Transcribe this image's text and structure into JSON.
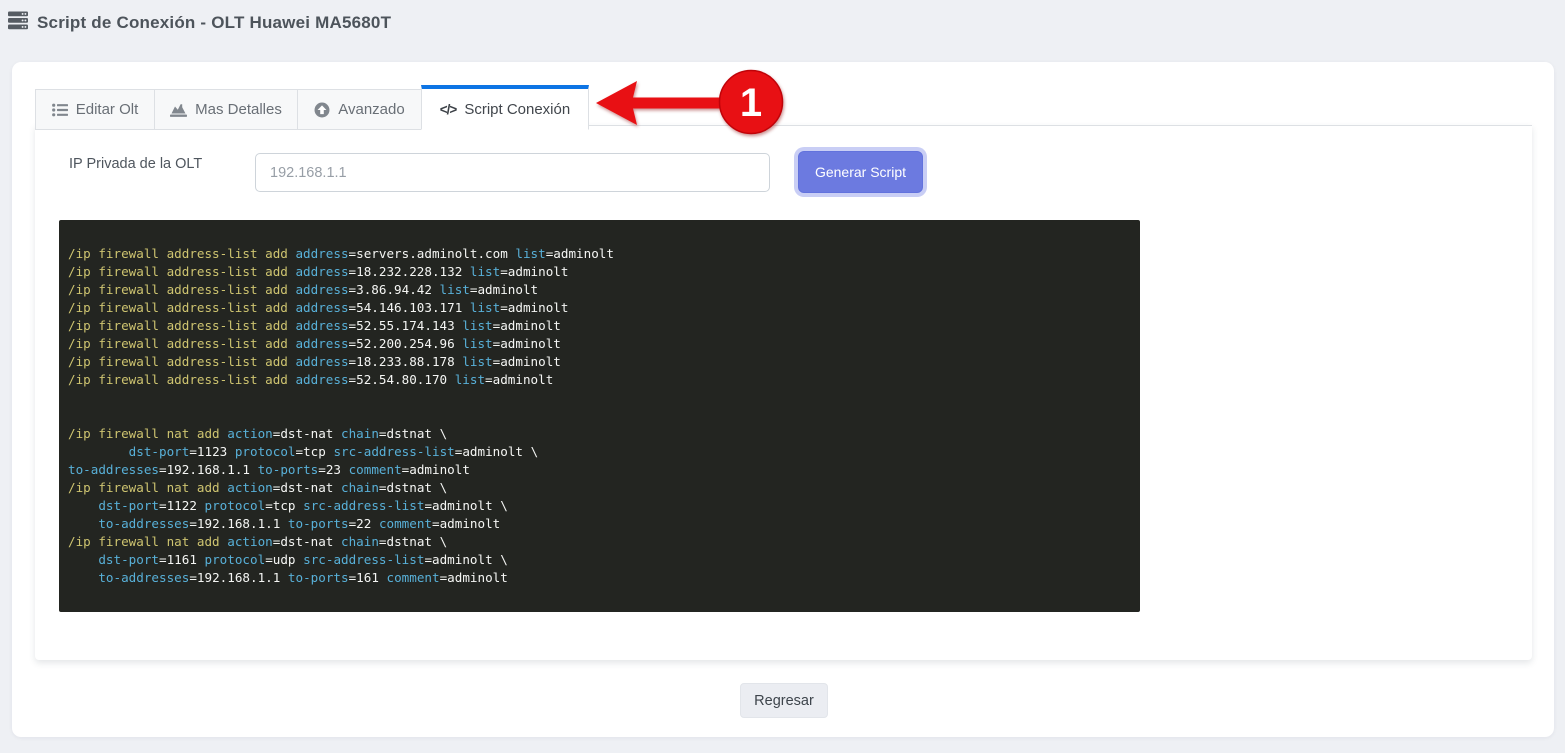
{
  "header": {
    "title": "Script de Conexión - OLT Huawei MA5680T"
  },
  "tabs": [
    {
      "label": "Editar Olt",
      "icon": "list-icon",
      "active": false
    },
    {
      "label": "Mas Detalles",
      "icon": "chart-area-icon",
      "active": false
    },
    {
      "label": "Avanzado",
      "icon": "arrow-circle-up-icon",
      "active": false
    },
    {
      "label": "Script Conexión",
      "icon": "code-icon",
      "active": true
    }
  ],
  "icons": {
    "code_glyph": "</>"
  },
  "form": {
    "ip_label": "IP Privada de la OLT",
    "ip_value": "192.168.1.1",
    "generate_button": "Generar Script"
  },
  "script": {
    "lines": [
      [
        [
          "c",
          "/ip firewall address-list add "
        ],
        [
          "p",
          "address"
        ],
        [
          "v",
          "=servers.adminolt.com "
        ],
        [
          "p",
          "list"
        ],
        [
          "v",
          "=adminolt"
        ]
      ],
      [
        [
          "c",
          "/ip firewall address-list add "
        ],
        [
          "p",
          "address"
        ],
        [
          "v",
          "=18.232.228.132 "
        ],
        [
          "p",
          "list"
        ],
        [
          "v",
          "=adminolt"
        ]
      ],
      [
        [
          "c",
          "/ip firewall address-list add "
        ],
        [
          "p",
          "address"
        ],
        [
          "v",
          "=3.86.94.42 "
        ],
        [
          "p",
          "list"
        ],
        [
          "v",
          "=adminolt"
        ]
      ],
      [
        [
          "c",
          "/ip firewall address-list add "
        ],
        [
          "p",
          "address"
        ],
        [
          "v",
          "=54.146.103.171 "
        ],
        [
          "p",
          "list"
        ],
        [
          "v",
          "=adminolt"
        ]
      ],
      [
        [
          "c",
          "/ip firewall address-list add "
        ],
        [
          "p",
          "address"
        ],
        [
          "v",
          "=52.55.174.143 "
        ],
        [
          "p",
          "list"
        ],
        [
          "v",
          "=adminolt"
        ]
      ],
      [
        [
          "c",
          "/ip firewall address-list add "
        ],
        [
          "p",
          "address"
        ],
        [
          "v",
          "=52.200.254.96 "
        ],
        [
          "p",
          "list"
        ],
        [
          "v",
          "=adminolt"
        ]
      ],
      [
        [
          "c",
          "/ip firewall address-list add "
        ],
        [
          "p",
          "address"
        ],
        [
          "v",
          "=18.233.88.178 "
        ],
        [
          "p",
          "list"
        ],
        [
          "v",
          "=adminolt"
        ]
      ],
      [
        [
          "c",
          "/ip firewall address-list add "
        ],
        [
          "p",
          "address"
        ],
        [
          "v",
          "=52.54.80.170 "
        ],
        [
          "p",
          "list"
        ],
        [
          "v",
          "=adminolt"
        ]
      ],
      [],
      [],
      [
        [
          "c",
          "/ip firewall nat add "
        ],
        [
          "p",
          "action"
        ],
        [
          "v",
          "=dst-nat "
        ],
        [
          "p",
          "chain"
        ],
        [
          "v",
          "=dstnat \\"
        ]
      ],
      [
        [
          "v",
          "        "
        ],
        [
          "p",
          "dst-port"
        ],
        [
          "v",
          "=1123 "
        ],
        [
          "p",
          "protocol"
        ],
        [
          "v",
          "=tcp "
        ],
        [
          "p",
          "src-address-list"
        ],
        [
          "v",
          "=adminolt \\"
        ]
      ],
      [
        [
          "p",
          "to-addresses"
        ],
        [
          "v",
          "=192.168.1.1 "
        ],
        [
          "p",
          "to-ports"
        ],
        [
          "v",
          "=23 "
        ],
        [
          "p",
          "comment"
        ],
        [
          "v",
          "=adminolt"
        ]
      ],
      [
        [
          "c",
          "/ip firewall nat add "
        ],
        [
          "p",
          "action"
        ],
        [
          "v",
          "=dst-nat "
        ],
        [
          "p",
          "chain"
        ],
        [
          "v",
          "=dstnat \\"
        ]
      ],
      [
        [
          "v",
          "    "
        ],
        [
          "p",
          "dst-port"
        ],
        [
          "v",
          "=1122 "
        ],
        [
          "p",
          "protocol"
        ],
        [
          "v",
          "=tcp "
        ],
        [
          "p",
          "src-address-list"
        ],
        [
          "v",
          "=adminolt \\"
        ]
      ],
      [
        [
          "v",
          "    "
        ],
        [
          "p",
          "to-addresses"
        ],
        [
          "v",
          "=192.168.1.1 "
        ],
        [
          "p",
          "to-ports"
        ],
        [
          "v",
          "=22 "
        ],
        [
          "p",
          "comment"
        ],
        [
          "v",
          "=adminolt"
        ]
      ],
      [
        [
          "c",
          "/ip firewall nat add "
        ],
        [
          "p",
          "action"
        ],
        [
          "v",
          "=dst-nat "
        ],
        [
          "p",
          "chain"
        ],
        [
          "v",
          "=dstnat \\"
        ]
      ],
      [
        [
          "v",
          "    "
        ],
        [
          "p",
          "dst-port"
        ],
        [
          "v",
          "=1161 "
        ],
        [
          "p",
          "protocol"
        ],
        [
          "v",
          "=udp "
        ],
        [
          "p",
          "src-address-list"
        ],
        [
          "v",
          "=adminolt \\"
        ]
      ],
      [
        [
          "v",
          "    "
        ],
        [
          "p",
          "to-addresses"
        ],
        [
          "v",
          "=192.168.1.1 "
        ],
        [
          "p",
          "to-ports"
        ],
        [
          "v",
          "=161 "
        ],
        [
          "p",
          "comment"
        ],
        [
          "v",
          "=adminolt"
        ]
      ]
    ]
  },
  "footer": {
    "back_button": "Regresar"
  },
  "annotation": {
    "step_number": "1"
  },
  "colors": {
    "page_bg": "#eef0f4",
    "active_tab_accent": "#0d74e4",
    "primary_button": "#6c7ae0",
    "primary_button_ring": "#c9cef5",
    "code_bg": "#232521",
    "code_command": "#cec470",
    "code_param": "#58b0d8",
    "code_value": "#f5f6f4",
    "annotation_red": "#e81014"
  }
}
